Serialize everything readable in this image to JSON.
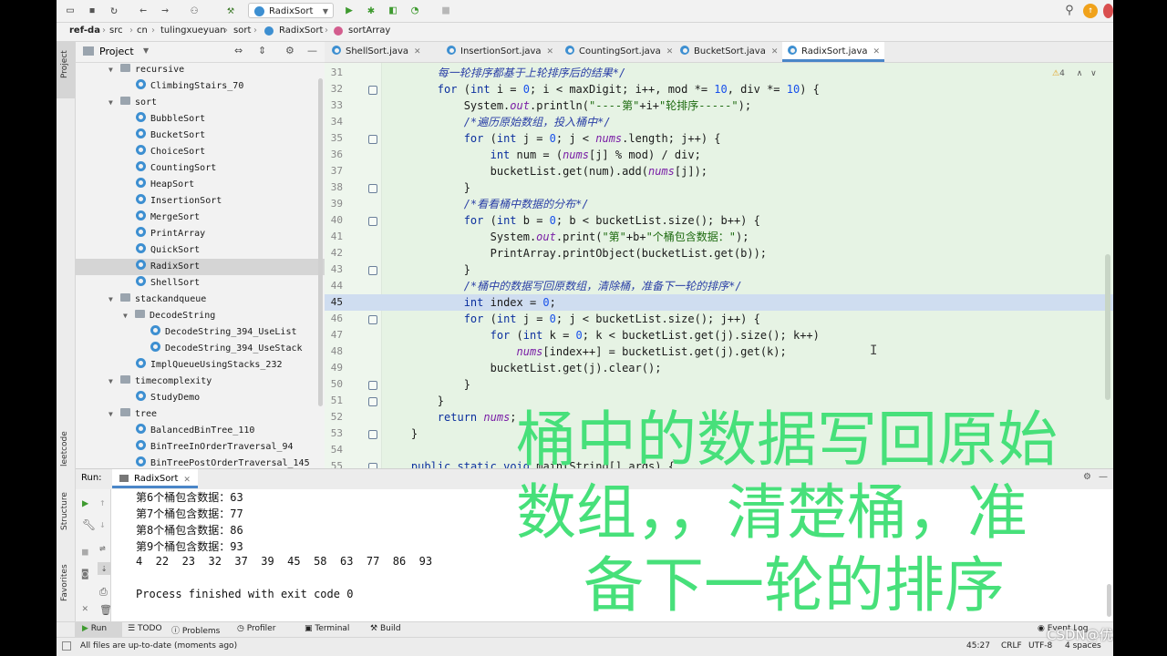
{
  "toolbar": {
    "run_config": "RadixSort",
    "icons": [
      "folder-icon",
      "save-icon",
      "sync-icon",
      "back-icon",
      "forward-icon",
      "vcs-icon",
      "build-hammer-icon",
      "run-icon",
      "debug-icon",
      "coverage-icon",
      "profile-icon",
      "stop-icon",
      "search-icon",
      "update-icon",
      "avatar-icon"
    ]
  },
  "breadcrumb": [
    "ref-da",
    "src",
    "cn",
    "tulingxueyuan",
    "sort",
    "RadixSort",
    "sortArray"
  ],
  "project": {
    "title": "Project",
    "tree": [
      {
        "label": "recursive",
        "kind": "folder",
        "level": 1
      },
      {
        "label": "ClimbingStairs_70",
        "kind": "class",
        "level": 2
      },
      {
        "label": "sort",
        "kind": "folder",
        "level": 1
      },
      {
        "label": "BubbleSort",
        "kind": "class",
        "level": 2
      },
      {
        "label": "BucketSort",
        "kind": "class",
        "level": 2
      },
      {
        "label": "ChoiceSort",
        "kind": "class",
        "level": 2
      },
      {
        "label": "CountingSort",
        "kind": "class",
        "level": 2
      },
      {
        "label": "HeapSort",
        "kind": "class",
        "level": 2
      },
      {
        "label": "InsertionSort",
        "kind": "class",
        "level": 2
      },
      {
        "label": "MergeSort",
        "kind": "class",
        "level": 2
      },
      {
        "label": "PrintArray",
        "kind": "class",
        "level": 2
      },
      {
        "label": "QuickSort",
        "kind": "class",
        "level": 2
      },
      {
        "label": "RadixSort",
        "kind": "class",
        "level": 2,
        "selected": true
      },
      {
        "label": "ShellSort",
        "kind": "class",
        "level": 2
      },
      {
        "label": "stackandqueue",
        "kind": "folder",
        "level": 1
      },
      {
        "label": "DecodeString",
        "kind": "folder",
        "level": 2
      },
      {
        "label": "DecodeString_394_UseList",
        "kind": "class",
        "level": 3
      },
      {
        "label": "DecodeString_394_UseStack",
        "kind": "class",
        "level": 3
      },
      {
        "label": "ImplQueueUsingStacks_232",
        "kind": "class",
        "level": 2
      },
      {
        "label": "timecomplexity",
        "kind": "folder",
        "level": 1
      },
      {
        "label": "StudyDemo",
        "kind": "class",
        "level": 2
      },
      {
        "label": "tree",
        "kind": "folder",
        "level": 1
      },
      {
        "label": "BalancedBinTree_110",
        "kind": "class",
        "level": 2
      },
      {
        "label": "BinTreeInOrderTraversal_94",
        "kind": "class",
        "level": 2
      },
      {
        "label": "BinTreePostOrderTraversal_145",
        "kind": "class",
        "level": 2
      }
    ]
  },
  "tabs": [
    {
      "label": "ShellSort.java"
    },
    {
      "label": "InsertionSort.java"
    },
    {
      "label": "CountingSort.java"
    },
    {
      "label": "BucketSort.java"
    },
    {
      "label": "RadixSort.java",
      "active": true
    }
  ],
  "editor": {
    "warning_count": "4",
    "current_line": 45,
    "lines": [
      {
        "n": 31,
        "t": "        每一轮排序都基于上轮排序后的结果*/",
        "c": "cm"
      },
      {
        "n": 32,
        "t": "        for (int i = 0; i < maxDigit; i++, mod *= 10, div *= 10) {"
      },
      {
        "n": 33,
        "t": "            System.out.println(\"----第\"+i+\"轮排序-----\");"
      },
      {
        "n": 34,
        "t": "            /*遍历原始数组，投入桶中*/",
        "c": "cm"
      },
      {
        "n": 35,
        "t": "            for (int j = 0; j < nums.length; j++) {"
      },
      {
        "n": 36,
        "t": "                int num = (nums[j] % mod) / div;"
      },
      {
        "n": 37,
        "t": "                bucketList.get(num).add(nums[j]);"
      },
      {
        "n": 38,
        "t": "            }"
      },
      {
        "n": 39,
        "t": "            /*看看桶中数据的分布*/",
        "c": "cm"
      },
      {
        "n": 40,
        "t": "            for (int b = 0; b < bucketList.size(); b++) {"
      },
      {
        "n": 41,
        "t": "                System.out.print(\"第\"+b+\"个桶包含数据：\");"
      },
      {
        "n": 42,
        "t": "                PrintArray.printObject(bucketList.get(b));"
      },
      {
        "n": 43,
        "t": "            }"
      },
      {
        "n": 44,
        "t": "            /*桶中的数据写回原数组，清除桶，准备下一轮的排序*/",
        "c": "cm"
      },
      {
        "n": 45,
        "t": "            int index = 0;"
      },
      {
        "n": 46,
        "t": "            for (int j = 0; j < bucketList.size(); j++) {"
      },
      {
        "n": 47,
        "t": "                for (int k = 0; k < bucketList.get(j).size(); k++)"
      },
      {
        "n": 48,
        "t": "                    nums[index++] = bucketList.get(j).get(k);"
      },
      {
        "n": 49,
        "t": "                bucketList.get(j).clear();"
      },
      {
        "n": 50,
        "t": "            }"
      },
      {
        "n": 51,
        "t": "        }"
      },
      {
        "n": 52,
        "t": "        return nums;"
      },
      {
        "n": 53,
        "t": "    }"
      },
      {
        "n": 54,
        "t": ""
      },
      {
        "n": 55,
        "t": "    public static void main(String[] args) {"
      }
    ]
  },
  "caption": [
    "桶中的数据写回原始",
    "数组，，清楚桶，准",
    "备下一轮的排序"
  ],
  "run": {
    "label": "Run:",
    "config": "RadixSort",
    "output": [
      "第6个桶包含数据：63",
      "第7个桶包含数据：77",
      "第8个桶包含数据：86",
      "第9个桶包含数据：93",
      "4  22  23  32  37  39  45  58  63  77  86  93",
      "",
      "Process finished with exit code 0"
    ]
  },
  "side_labels": {
    "project": "Project",
    "structure": "Structure",
    "favorites": "Favorites",
    "leetcode": "leetcode"
  },
  "toolwindows": [
    "Run",
    "TODO",
    "Problems",
    "Profiler",
    "Terminal",
    "Build"
  ],
  "event_log": "Event Log",
  "status": {
    "message": "All files are up-to-date (moments ago)",
    "position": "45:27",
    "line_sep": "CRLF",
    "encoding": "UTF-8",
    "indent": "4 spaces"
  },
  "watermark": "CSDN@优利德"
}
